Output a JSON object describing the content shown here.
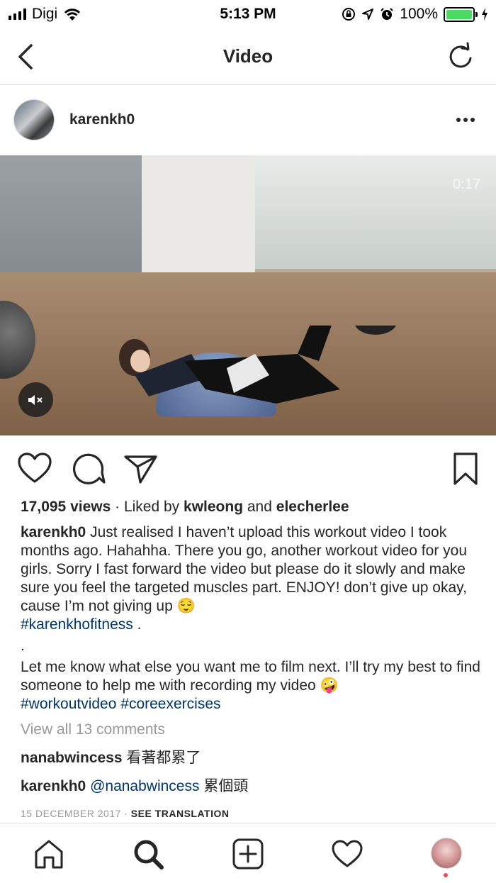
{
  "status_bar": {
    "carrier": "Digi",
    "time": "5:13 PM",
    "battery_percent": "100%"
  },
  "nav": {
    "title": "Video"
  },
  "post": {
    "username": "karenkh0",
    "video_timer": "0:17",
    "views": "17,095 views",
    "liked_by_prefix": "· Liked by",
    "liked_by_user1": "kwleong",
    "liked_by_and": "and",
    "liked_by_user2": "elecherlee",
    "caption_user": "karenkh0",
    "caption_text": "Just realised I haven’t upload this workout video I took months ago. Hahahha. There you go, another workout video for you girls. Sorry I fast forward the video but please do it slowly and make sure you feel the targeted muscles part. ENJOY! don’t give up okay, cause I’m not giving up 😌",
    "hashtag1": "#karenkhofitness",
    "hashtag1_suffix": " .",
    "dot_line": ".",
    "caption_text2": "Let me know what else you want me to film next. I’ll try my best to find someone to help me with recording my video 🤪",
    "hashtag2": "#workoutvideo",
    "hashtag3": "#coreexercises",
    "view_comments": "View all 13 comments",
    "comments": [
      {
        "user": "nanabwincess",
        "mention": "",
        "text": "看著都累了"
      },
      {
        "user": "karenkh0",
        "mention": "@nanabwincess",
        "text": "累個頭"
      }
    ],
    "date": "15 DECEMBER 2017",
    "date_sep": "·",
    "see_translation": "SEE TRANSLATION"
  },
  "icons": {
    "status": [
      "signal-icon",
      "wifi-icon",
      "rotation-lock-icon",
      "location-icon",
      "alarm-icon",
      "battery-icon",
      "charging-icon"
    ],
    "nav": [
      "back-icon",
      "refresh-icon"
    ],
    "post": [
      "more-icon",
      "mute-icon",
      "heart-icon",
      "comment-icon",
      "share-icon",
      "bookmark-icon"
    ],
    "tabs": [
      "home-icon",
      "search-icon",
      "add-icon",
      "activity-icon",
      "profile-icon"
    ]
  },
  "colors": {
    "battery_fill": "#4cd964",
    "hashtag": "#003569",
    "muted_text": "#999999",
    "notification_dot": "#ed4956"
  }
}
